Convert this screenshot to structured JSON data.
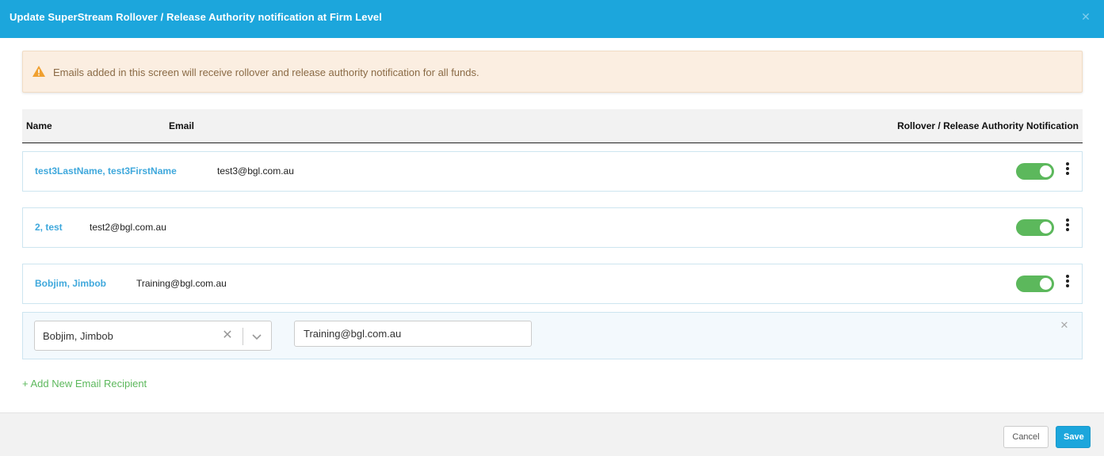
{
  "header": {
    "title": "Update SuperStream Rollover / Release Authority notification at Firm Level",
    "close_icon": "close-icon"
  },
  "alert": {
    "icon": "warning-icon",
    "text": "Emails added in this screen will receive rollover and release authority notification for all funds.",
    "color": "#f0a030"
  },
  "table": {
    "columns": {
      "name": "Name",
      "email": "Email",
      "notification": "Rollover / Release Authority Notification"
    },
    "rows": [
      {
        "name": "test3LastName, test3FirstName",
        "email": "test3@bgl.com.au",
        "notification_on": true
      },
      {
        "name": "2, test",
        "email": "test2@bgl.com.au",
        "notification_on": true
      },
      {
        "name": "Bobjim, Jimbob",
        "email": "Training@bgl.com.au",
        "notification_on": true
      }
    ]
  },
  "edit_row": {
    "selected_name": "Bobjim, Jimbob",
    "email_value": "Training@bgl.com.au"
  },
  "add_link": "+ Add New Email Recipient",
  "footer": {
    "cancel_label": "Cancel",
    "save_label": "Save"
  },
  "colors": {
    "brand": "#1ca6dc",
    "toggle_on": "#5cb85c",
    "link": "#3fa8dc",
    "add_link": "#5cb85c"
  }
}
